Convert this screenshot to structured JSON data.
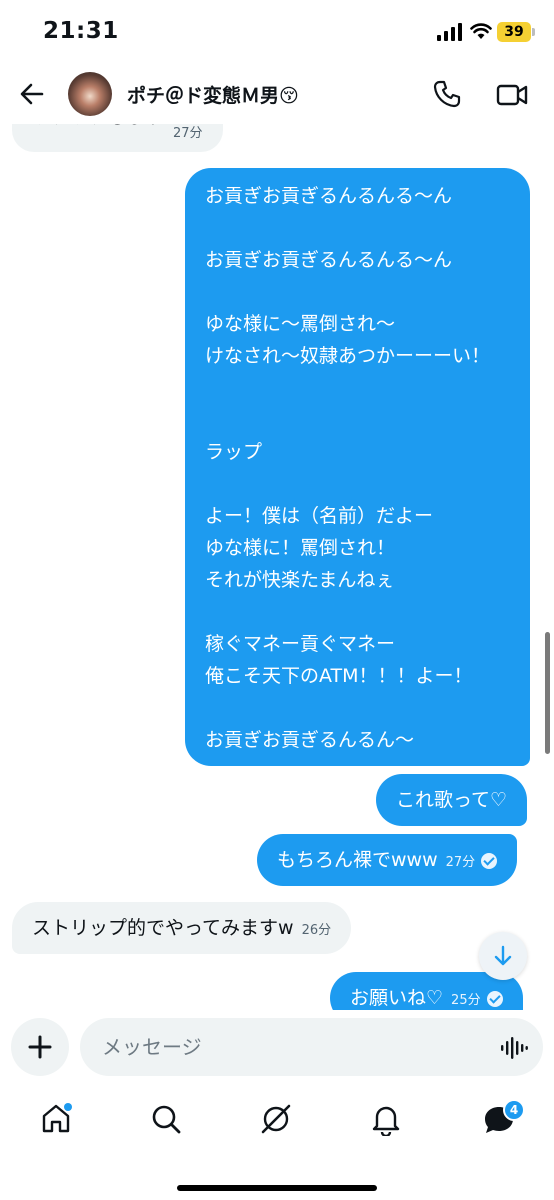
{
  "status_bar": {
    "time": "21:31",
    "battery": "39"
  },
  "header": {
    "name": "ポチ＠ド変態Ｍ男😚"
  },
  "messages": [
    {
      "from": "them",
      "text": "ワクワクします",
      "time": "27分"
    },
    {
      "from": "me",
      "lines": [
        "お貢ぎお貢ぎるんるんる〜ん",
        "",
        "お貢ぎお貢ぎるんるんる〜ん",
        "",
        "ゆな様に〜罵倒され〜",
        "けなされ〜奴隷あつかーーーい！",
        "",
        "",
        "ラップ",
        "",
        "よー！僕は（名前）だよー",
        "ゆな様に！罵倒され！",
        "それが快楽たまんねぇ",
        "",
        "稼ぐマネー貢ぐマネー",
        "俺こそ天下のATM！！！よー！",
        "",
        "お貢ぎお貢ぎるんるん〜"
      ]
    },
    {
      "from": "me",
      "text": "これ歌って♡"
    },
    {
      "from": "me",
      "text": "もちろん裸でwww",
      "time": "27分"
    },
    {
      "from": "them",
      "text": "ストリップ的でやってみますw",
      "time": "26分"
    },
    {
      "from": "me",
      "text": "お願いね♡",
      "time": "25分"
    }
  ],
  "composer": {
    "placeholder": "メッセージ"
  },
  "tabbar": {
    "items": [
      "home-icon",
      "search-icon",
      "grok-icon",
      "bell-icon",
      "messages-icon"
    ],
    "messages_badge": "4"
  }
}
